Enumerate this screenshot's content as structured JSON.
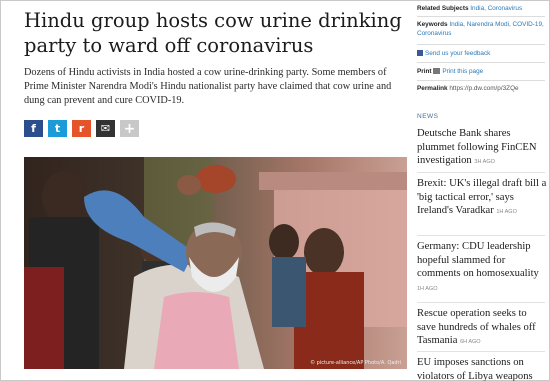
{
  "article": {
    "headline": "Hindu group hosts cow urine drinking party to ward off coronavirus",
    "lead": "Dozens of Hindu activists in India hosted a cow urine-drinking party. Some members of Prime Minister Narendra Modi's Hindu nationalist party have claimed that cow urine and dung can prevent and cure COVID-19.",
    "photo_credit": "© picture-alliance/AP Photo/A. Qadri"
  },
  "share": {
    "icons": [
      "facebook-icon",
      "twitter-icon",
      "reddit-icon",
      "email-icon",
      "plus-icon"
    ],
    "labels": [
      "f",
      "t",
      "r",
      "✉",
      "+"
    ]
  },
  "sidebar": {
    "related_label": "Related Subjects",
    "related_value": "India, Coronavirus",
    "keywords_label": "Keywords",
    "keywords_value": "India, Narendra Modi, COVID-19, Coronavirus",
    "feedback": "Send us your feedback",
    "print_label": "Print",
    "print_link": "Print this page",
    "permalink_label": "Permalink",
    "permalink_value": "https://p.dw.com/p/3ZQe",
    "news_heading": "NEWS",
    "news": [
      {
        "title": "Deutsche Bank shares plummet following FinCEN investigation",
        "ago": "3H AGO"
      },
      {
        "title": "Brexit: UK's illegal draft bill a 'big tactical error,' says Ireland's Varadkar",
        "ago": "1H AGO"
      },
      {
        "title": "Germany: CDU leadership hopeful slammed for comments on homosexuality",
        "ago": "1H AGO"
      },
      {
        "title": "Rescue operation seeks to save hundreds of whales off Tasmania",
        "ago": "6H AGO"
      },
      {
        "title": "EU imposes sanctions on violators of Libya weapons",
        "ago": ""
      }
    ]
  }
}
